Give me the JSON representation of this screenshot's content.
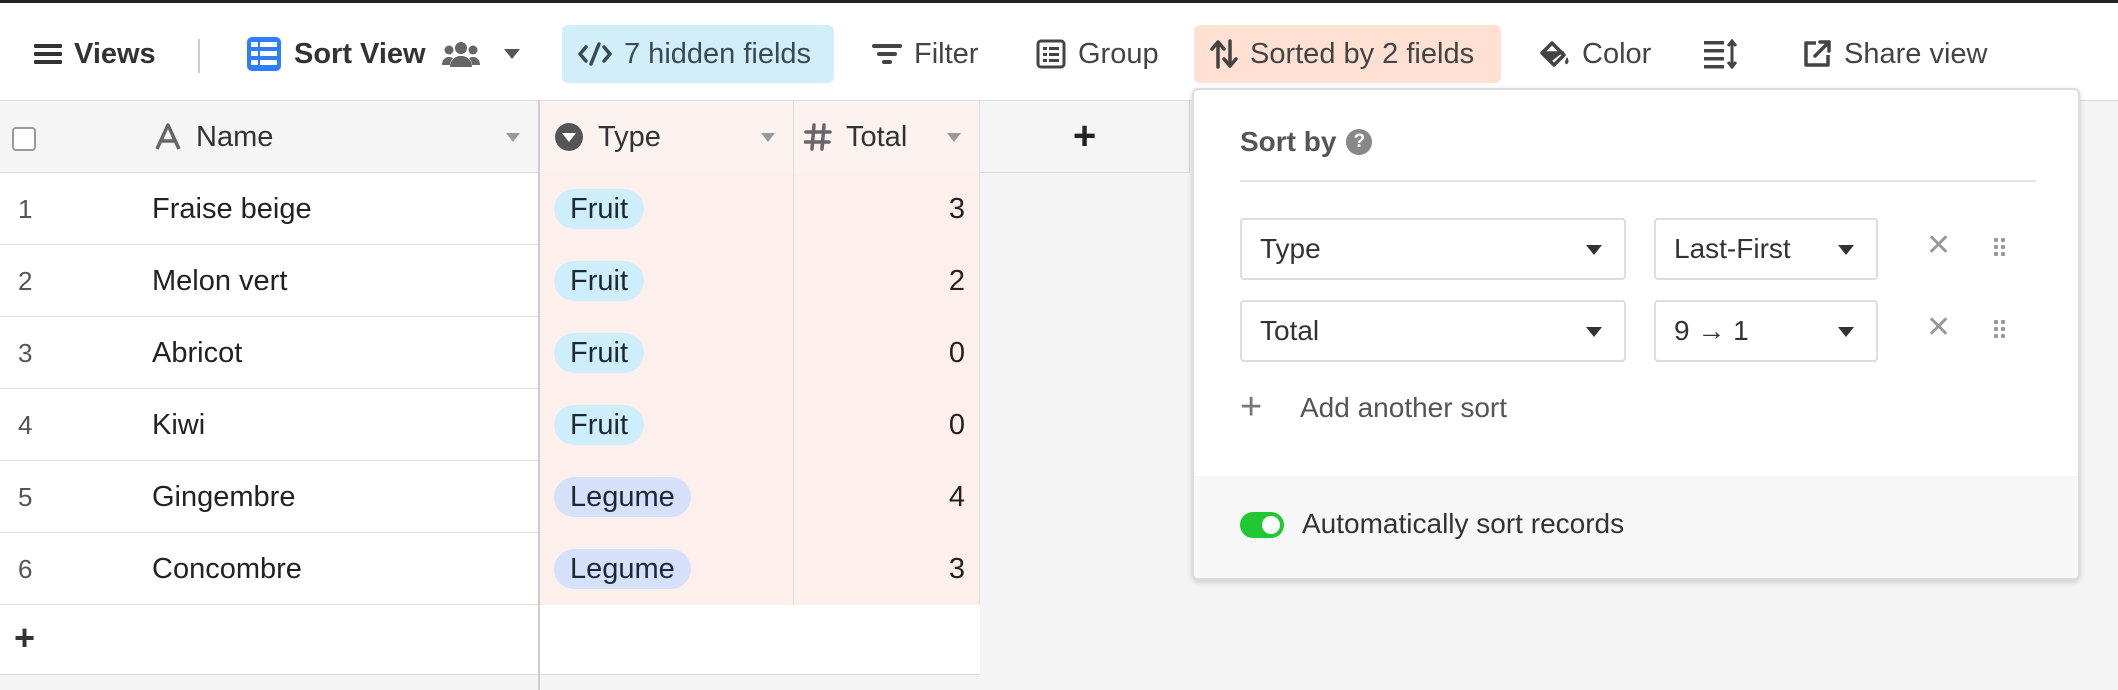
{
  "toolbar": {
    "views_label": "Views",
    "view_name": "Sort View",
    "hidden_fields_label": "7 hidden fields",
    "filter_label": "Filter",
    "group_label": "Group",
    "sorted_label": "Sorted by 2 fields",
    "color_label": "Color",
    "share_label": "Share view"
  },
  "grid": {
    "columns": [
      {
        "label": "Name",
        "icon": "text-field-icon"
      },
      {
        "label": "Type",
        "icon": "single-select-icon"
      },
      {
        "label": "Total",
        "icon": "number-field-icon"
      }
    ],
    "add_column_label": "+",
    "rows": [
      {
        "num": "1",
        "name": "Fraise beige",
        "type": "Fruit",
        "total": "3"
      },
      {
        "num": "2",
        "name": "Melon vert",
        "type": "Fruit",
        "total": "2"
      },
      {
        "num": "3",
        "name": "Abricot",
        "type": "Fruit",
        "total": "0"
      },
      {
        "num": "4",
        "name": "Kiwi",
        "type": "Fruit",
        "total": "0"
      },
      {
        "num": "5",
        "name": "Gingembre",
        "type": "Legume",
        "total": "4"
      },
      {
        "num": "6",
        "name": "Concombre",
        "type": "Legume",
        "total": "3"
      }
    ],
    "add_row_label": "+"
  },
  "sort_panel": {
    "title": "Sort by",
    "help_glyph": "?",
    "sorts": [
      {
        "field": "Type",
        "direction": "Last-First"
      },
      {
        "field": "Total",
        "direction": "9 → 1"
      }
    ],
    "add_sort_label": "Add another sort",
    "auto_sort_label": "Automatically sort records",
    "auto_sort_enabled": true
  },
  "colors": {
    "hidden_fields_bg": "#d3eefb",
    "sorted_bg": "#ffe0d3",
    "fruit_pill": "#cfeefb",
    "legume_pill": "#d6e0fb",
    "toggle_on": "#20c933",
    "accent_blue": "#2d7ff9"
  }
}
